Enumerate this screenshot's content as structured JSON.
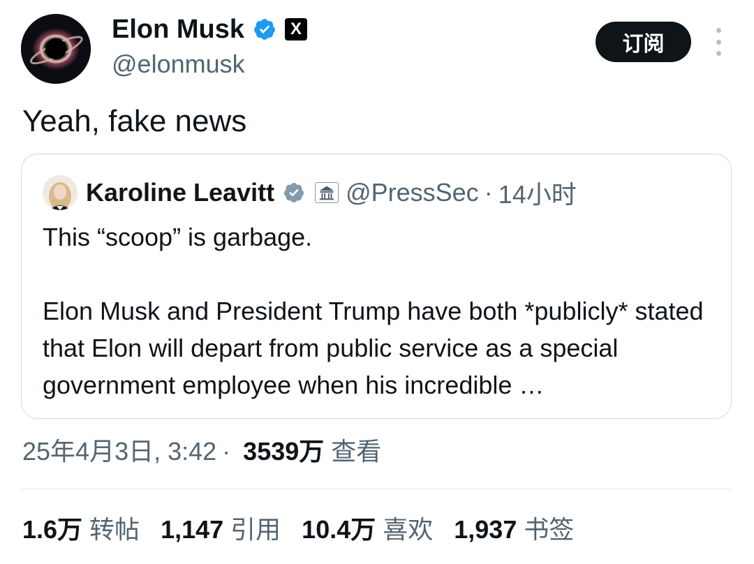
{
  "author": {
    "name": "Elon Musk",
    "handle": "@elonmusk",
    "x_badge": "X"
  },
  "subscribe_label": "订阅",
  "post_text": "Yeah, fake news",
  "quote": {
    "name": "Karoline Leavitt",
    "handle": "@PressSec",
    "separator": "·",
    "time": "14小时",
    "paragraph1": "This “scoop” is garbage.",
    "paragraph2": "Elon Musk and President Trump have both *publicly* stated that Elon will depart from public service as a special government employee when his incredible …"
  },
  "meta": {
    "date": "25年4月3日, 3:42",
    "separator": "·",
    "views_count": "3539万",
    "views_label": "查看"
  },
  "stats": [
    {
      "count": "1.6万",
      "label": "转帖"
    },
    {
      "count": "1,147",
      "label": "引用"
    },
    {
      "count": "10.4万",
      "label": "喜欢"
    },
    {
      "count": "1,937",
      "label": "书签"
    }
  ],
  "colors": {
    "verified_blue": "#1d9bf0",
    "gov_gray": "#829aab",
    "text_primary": "#0f1419",
    "text_secondary": "#536471"
  },
  "icons": {
    "verified": "verified-badge-icon",
    "more": "more-options-icon",
    "government": "government-affiliation-icon"
  }
}
